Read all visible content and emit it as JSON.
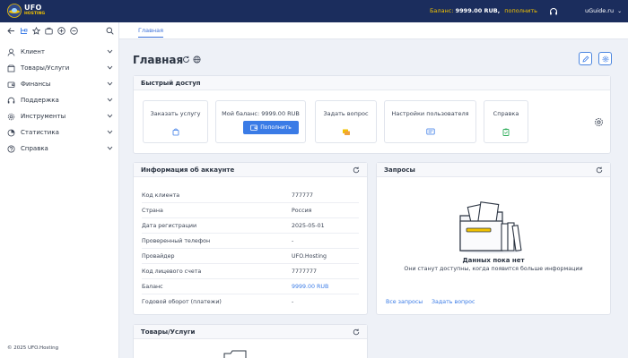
{
  "header": {
    "logo_top": "UFO",
    "logo_bottom": "HOSTING",
    "balance_label": "Баланс:",
    "balance_value": "9999.00 RUB,",
    "topup_link": "пополнить",
    "user_name": "uGuide.ru",
    "icons": [
      "ufo-logo-icon",
      "support-icon",
      "chevron-down-icon"
    ]
  },
  "sidebar": {
    "tool_icons": [
      "back-arrow-icon",
      "tree-icon",
      "star-icon",
      "briefcase-icon",
      "add-circle-icon",
      "minus-circle-icon",
      "search-icon"
    ],
    "items": [
      {
        "label": "Клиент",
        "icon": "user-icon"
      },
      {
        "label": "Товары/Услуги",
        "icon": "box-icon"
      },
      {
        "label": "Финансы",
        "icon": "wallet-icon"
      },
      {
        "label": "Поддержка",
        "icon": "headset-icon"
      },
      {
        "label": "Инструменты",
        "icon": "gear-icon"
      },
      {
        "label": "Статистика",
        "icon": "pie-chart-icon"
      },
      {
        "label": "Справка",
        "icon": "help-circle-icon"
      }
    ],
    "footer": "© 2025 UFO.Hosting"
  },
  "tabs": [
    {
      "label": "Главная",
      "active": true
    }
  ],
  "page": {
    "title": "Главная",
    "title_icons": [
      "refresh-icon",
      "globe-icon"
    ],
    "header_buttons": [
      "edit-icon",
      "settings-icon"
    ]
  },
  "quick_access": {
    "title": "Быстрый доступ",
    "tiles": [
      {
        "label": "Заказать услугу",
        "icon": "cart-icon"
      },
      {
        "label": "Мой баланс: 9999.00 RUB",
        "button": "Пополнить",
        "icon": "wallet-icon"
      },
      {
        "label": "Задать вопрос",
        "icon": "tickets-icon"
      },
      {
        "label": "Настройки пользователя",
        "icon": "id-card-icon"
      },
      {
        "label": "Справка",
        "icon": "clipboard-icon"
      }
    ]
  },
  "account_info": {
    "title": "Информация об аккаунте",
    "rows": [
      {
        "key": "Код клиента",
        "value": "777777"
      },
      {
        "key": "Страна",
        "value": "Россия"
      },
      {
        "key": "Дата регистрации",
        "value": "2025-05-01"
      },
      {
        "key": "Проверенный телефон",
        "value": "-"
      },
      {
        "key": "Провайдер",
        "value": "UFO.Hosting"
      },
      {
        "key": "Код лицевого счета",
        "value": "7777777"
      },
      {
        "key": "Баланс",
        "value": "9999.00 RUB"
      },
      {
        "key": "Годовой оборот (платежи)",
        "value": "-"
      }
    ]
  },
  "requests": {
    "title": "Запросы",
    "empty_title": "Данных пока нет",
    "empty_sub": "Они станут доступны, когда появится больше информации",
    "links": [
      "Все запросы",
      "Задать вопрос"
    ]
  },
  "products": {
    "title": "Товары/Услуги"
  },
  "colors": {
    "header_bg": "#1b2d5d",
    "accent": "#3a7be6",
    "highlight": "#f2c200",
    "page_bg": "#eef1f7"
  }
}
